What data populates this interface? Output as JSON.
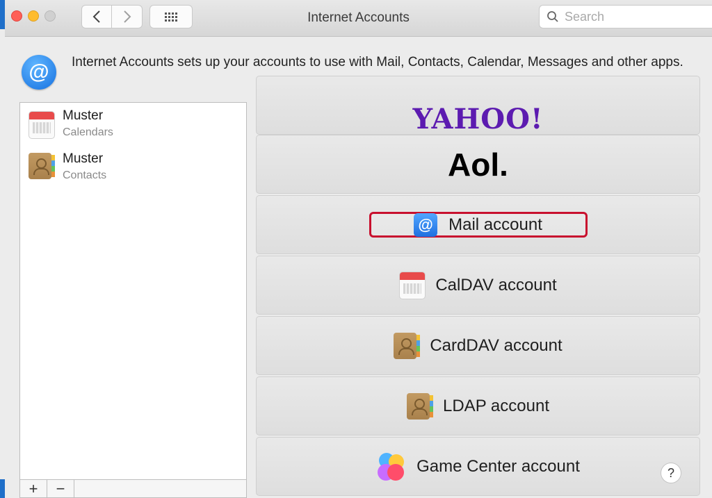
{
  "window": {
    "title": "Internet Accounts",
    "search_placeholder": "Search"
  },
  "header": {
    "description": "Internet Accounts sets up your accounts to use with Mail, Contacts, Calendar, Messages and other apps.",
    "icon": "at-sign-icon"
  },
  "accounts": [
    {
      "title": "Muster",
      "subtitle": "Calendars",
      "icon": "calendar-icon"
    },
    {
      "title": "Muster",
      "subtitle": "Contacts",
      "icon": "contacts-icon"
    }
  ],
  "list_controls": {
    "add": "+",
    "remove": "−"
  },
  "providers": {
    "yahoo": "YAHOO!",
    "aol": "Aol.",
    "mail": "Mail account",
    "caldav": "CalDAV account",
    "carddav": "CardDAV account",
    "ldap": "LDAP account",
    "gamecenter": "Game Center account"
  },
  "highlight_color": "#c8102e",
  "help": "?"
}
